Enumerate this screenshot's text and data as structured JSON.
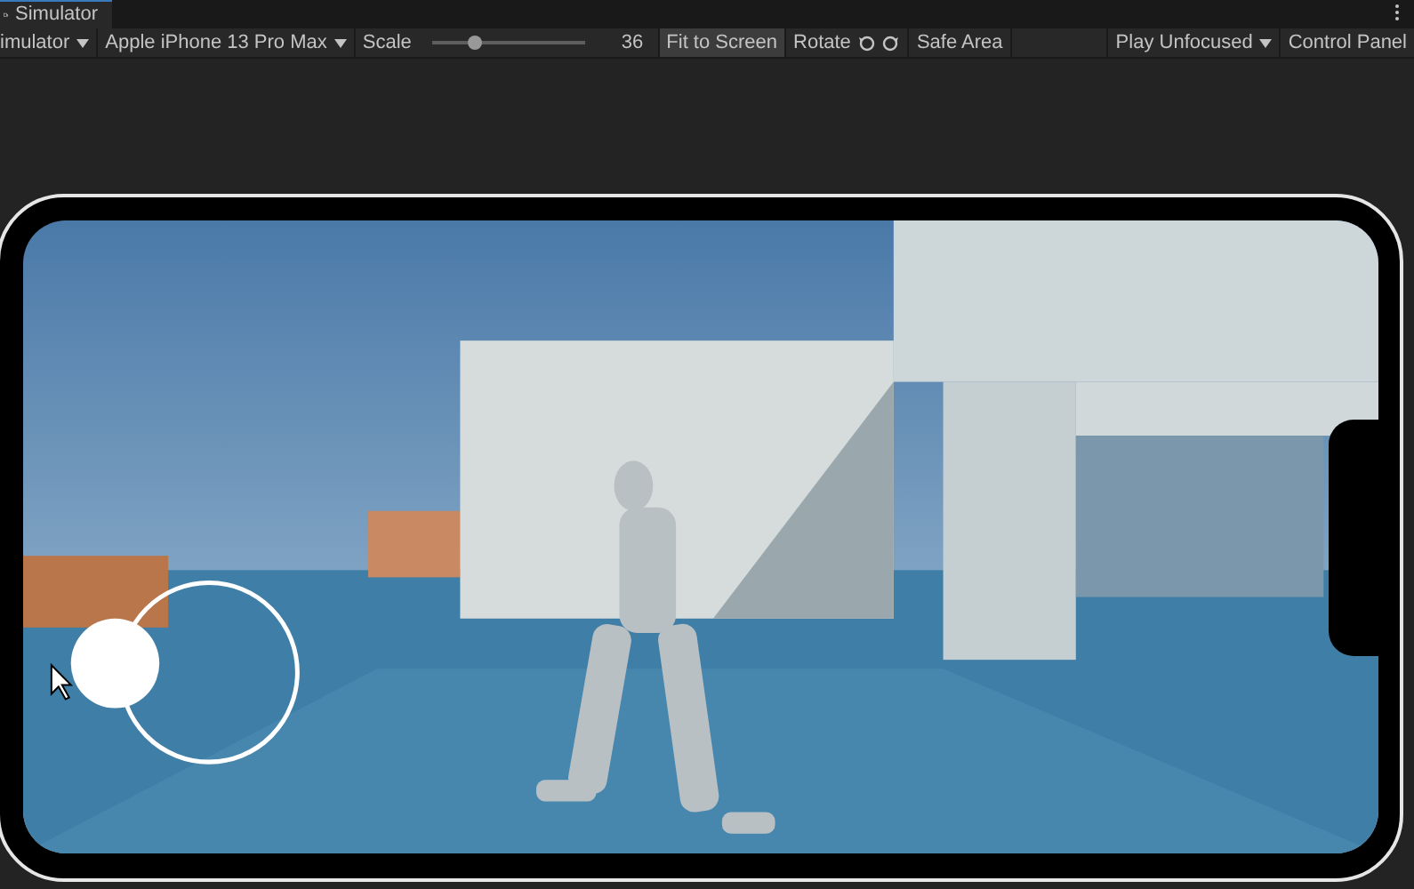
{
  "window": {
    "title": "Simulator"
  },
  "toolbar": {
    "mode": "imulator",
    "device": "Apple iPhone 13 Pro Max",
    "scale_label": "Scale",
    "scale": {
      "level": 0.28
    },
    "scale_value": "36",
    "fit_button": "Fit to Screen",
    "rotate_label": "Rotate",
    "safe_area": "Safe Area",
    "play_mode": "Play Unfocused",
    "control_panel": "Control Panel"
  }
}
